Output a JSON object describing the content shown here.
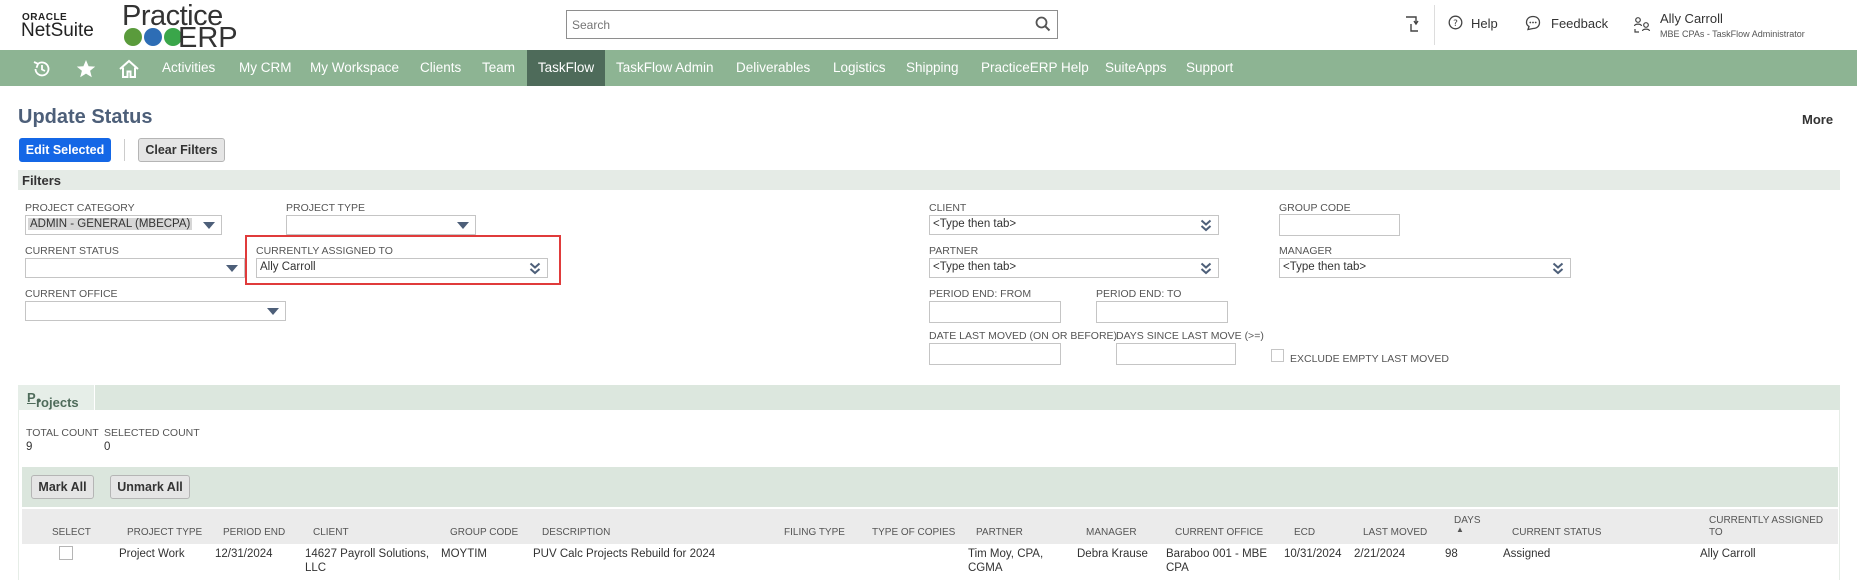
{
  "header": {
    "logo_oracle": "ORACLE",
    "logo_netsuite": "NetSuite",
    "logo_practice": "Practice",
    "logo_erp": "ERP",
    "search_placeholder": "Search",
    "help_label": "Help",
    "feedback_label": "Feedback",
    "user_name": "Ally Carroll",
    "user_role": "MBE CPAs - TaskFlow Administrator"
  },
  "nav": {
    "icons": [
      "recent-records-icon",
      "star-icon",
      "home-icon"
    ],
    "items": [
      "Activities",
      "My CRM",
      "My Workspace",
      "Clients",
      "Team",
      "TaskFlow",
      "TaskFlow Admin",
      "Deliverables",
      "Logistics",
      "Shipping",
      "PracticeERP Help",
      "SuiteApps",
      "Support"
    ],
    "active": "TaskFlow"
  },
  "page": {
    "title": "Update Status",
    "more_label": "More",
    "edit_selected_label": "Edit Selected",
    "clear_filters_label": "Clear Filters"
  },
  "filters": {
    "section_label": "Filters",
    "project_category": {
      "label": "PROJECT CATEGORY",
      "value": "ADMIN - GENERAL (MBECPA)"
    },
    "project_type": {
      "label": "PROJECT TYPE",
      "value": ""
    },
    "current_status": {
      "label": "CURRENT STATUS",
      "value": ""
    },
    "currently_assigned_to": {
      "label": "CURRENTLY ASSIGNED TO",
      "value": "Ally Carroll"
    },
    "current_office": {
      "label": "CURRENT OFFICE",
      "value": ""
    },
    "client": {
      "label": "CLIENT",
      "value": "<Type then tab>"
    },
    "partner": {
      "label": "PARTNER",
      "value": "<Type then tab>"
    },
    "period_end_from": {
      "label": "PERIOD END: FROM",
      "value": ""
    },
    "period_end_to": {
      "label": "PERIOD END: TO",
      "value": ""
    },
    "date_last_moved": {
      "label": "DATE LAST MOVED (ON OR BEFORE)",
      "value": ""
    },
    "days_since_last_move": {
      "label": "DAYS SINCE LAST MOVE (>=)",
      "value": ""
    },
    "exclude_empty_last_moved": {
      "label": "EXCLUDE EMPTY LAST MOVED",
      "checked": false
    },
    "group_code": {
      "label": "GROUP CODE",
      "value": ""
    },
    "manager": {
      "label": "MANAGER",
      "value": "<Type then tab>"
    }
  },
  "projects": {
    "tab_label": "Projects",
    "tab_label_u": "P",
    "tab_label_rest": "rojects",
    "total_count_label": "TOTAL COUNT",
    "total_count": "9",
    "selected_count_label": "SELECTED COUNT",
    "selected_count": "0",
    "mark_all_label": "Mark All",
    "unmark_all_label": "Unmark All",
    "columns": {
      "select": "SELECT",
      "project_type": "PROJECT TYPE",
      "period_end": "PERIOD END",
      "client": "CLIENT",
      "group_code": "GROUP CODE",
      "description": "DESCRIPTION",
      "filing_type": "FILING TYPE",
      "type_of_copies": "TYPE OF COPIES",
      "partner": "PARTNER",
      "manager": "MANAGER",
      "current_office": "CURRENT OFFICE",
      "ecd": "ECD",
      "last_moved": "LAST MOVED",
      "days": "DAYS",
      "days_sort": "▲",
      "current_status": "CURRENT STATUS",
      "currently_assigned_to_1": "CURRENTLY ASSIGNED",
      "currently_assigned_to_2": "TO"
    },
    "rows": [
      {
        "project_type": "Project Work",
        "period_end": "12/31/2024",
        "client": "14627 Payroll Solutions, LLC",
        "group_code": "MOYTIM",
        "description": "PUV Calc Projects Rebuild for 2024",
        "filing_type": "",
        "type_of_copies": "",
        "partner": "Tim Moy, CPA, CGMA",
        "manager": "Debra Krause",
        "current_office": "Baraboo 001 - MBE CPA",
        "ecd": "10/31/2024",
        "last_moved": "2/21/2024",
        "days": "98",
        "current_status": "Assigned",
        "currently_assigned_to": "Ally Carroll"
      }
    ]
  },
  "colors": {
    "nav_bg": "#8db493",
    "nav_active": "#4e6b5a",
    "primary_button": "#1467e6",
    "title": "#4d5f79",
    "highlight_box": "#e03b3b"
  }
}
